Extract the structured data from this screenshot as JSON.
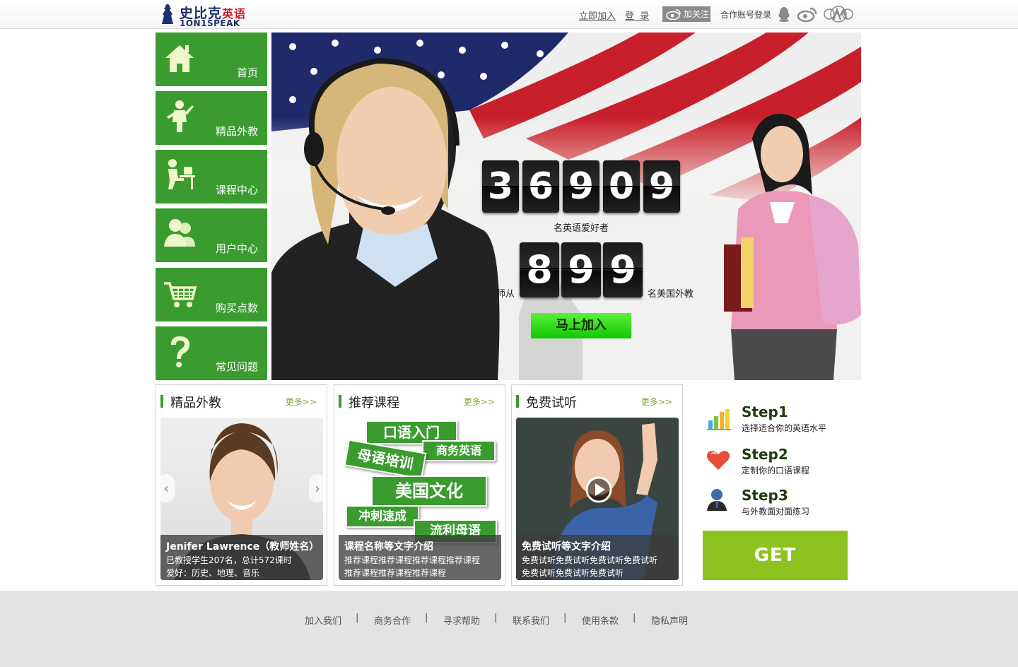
{
  "header": {
    "logo_cn": "史比克",
    "logo_cn_accent": "英语",
    "logo_en": "1ON1SPEAK",
    "join_link": "立即加入",
    "login_link": "登  录",
    "follow_label": "加关注",
    "partner_login": "合作账号登录"
  },
  "nav": [
    {
      "label": "首页",
      "icon": "home-icon"
    },
    {
      "label": "精品外教",
      "icon": "teacher-icon"
    },
    {
      "label": "课程中心",
      "icon": "course-icon"
    },
    {
      "label": "用户中心",
      "icon": "users-icon"
    },
    {
      "label": "购买点数",
      "icon": "cart-icon"
    },
    {
      "label": "常见问题",
      "icon": "question-icon"
    }
  ],
  "banner": {
    "lovers_digits": [
      "3",
      "6",
      "9",
      "0",
      "9"
    ],
    "lovers_label": "名英语爱好者",
    "teacher_prefix": "师从",
    "teacher_digits": [
      "8",
      "9",
      "9"
    ],
    "teacher_suffix": "名美国外教",
    "join_button": "马上加入"
  },
  "panels": {
    "teachers": {
      "title": "精品外教",
      "more": "更多>>",
      "name": "Jenifer Lawrence（教师姓名）",
      "line1": "已教授学生207名，总计572课时",
      "line2": "爱好：历史、地理、音乐"
    },
    "courses": {
      "title": "推荐课程",
      "more": "更多>>",
      "tags": [
        "口语入门",
        "商务英语",
        "母语培训",
        "美国文化",
        "冲刺速成",
        "流利母语"
      ],
      "caption_title": "课程名称等文字介绍",
      "line1": "推荐课程推荐课程推荐课程推荐课程",
      "line2": "推荐课程推荐课程推荐课程"
    },
    "trial": {
      "title": "免费试听",
      "more": "更多>>",
      "caption_title": "免费试听等文字介绍",
      "line1": "免费试听免费试听免费试听免费试听",
      "line2": "免费试听免费试听免费试听"
    }
  },
  "steps": [
    {
      "title": "Step1",
      "desc": "选择适合你的英语水平",
      "icon": "bar-chart-icon"
    },
    {
      "title": "Step2",
      "desc": "定制你的口语课程",
      "icon": "heart-icon"
    },
    {
      "title": "Step3",
      "desc": "与外教面对面练习",
      "icon": "user-icon"
    }
  ],
  "get_started": "GET STARTED",
  "footer": {
    "links": [
      "加入我们",
      "商务合作",
      "寻求帮助",
      "联系我们",
      "使用条款",
      "隐私声明"
    ],
    "separator": "|"
  },
  "colors": {
    "green": "#3a9c2f",
    "bright_green": "#8ec31f",
    "footer_bg": "#e3e3e3"
  }
}
